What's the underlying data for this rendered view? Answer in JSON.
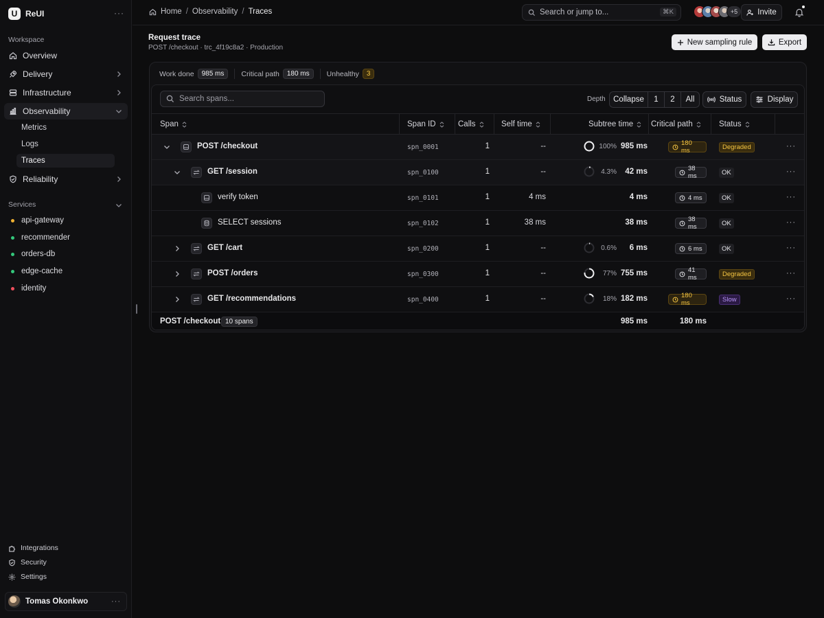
{
  "brand": {
    "name": "ReUI",
    "logo_letter": "U"
  },
  "sidebar": {
    "workspace_label": "Workspace",
    "items": [
      {
        "label": "Overview",
        "icon": "home-icon"
      },
      {
        "label": "Delivery",
        "icon": "rocket-icon"
      },
      {
        "label": "Infrastructure",
        "icon": "server-icon"
      },
      {
        "label": "Observability",
        "icon": "chart-icon"
      },
      {
        "label": "Reliability",
        "icon": "shield-check-icon"
      }
    ],
    "observability_sub": [
      {
        "label": "Metrics"
      },
      {
        "label": "Logs"
      },
      {
        "label": "Traces"
      }
    ],
    "services_label": "Services",
    "services": [
      {
        "label": "api-gateway",
        "color": "#f0b132"
      },
      {
        "label": "recommender",
        "color": "#34c77b"
      },
      {
        "label": "orders-db",
        "color": "#34c77b"
      },
      {
        "label": "edge-cache",
        "color": "#34c77b"
      },
      {
        "label": "identity",
        "color": "#ef4f5d"
      }
    ],
    "bottom_links": [
      {
        "label": "Integrations",
        "icon": "puzzle-icon"
      },
      {
        "label": "Security",
        "icon": "shield-icon"
      },
      {
        "label": "Settings",
        "icon": "gear-icon"
      }
    ],
    "user": {
      "name": "Tomas Okonkwo"
    }
  },
  "topbar": {
    "breadcrumb": [
      "Home",
      "Observability",
      "Traces"
    ],
    "search_placeholder": "Search or jump to...",
    "search_shortcut": "⌘K",
    "avatars_more": "+5",
    "invite_label": "Invite"
  },
  "page": {
    "title": "Request trace",
    "subtitle": "POST /checkout · trc_4f19c8a2 · Production",
    "new_rule_label": "New sampling rule",
    "export_label": "Export"
  },
  "stats": {
    "work_done_label": "Work done",
    "work_done_value": "985 ms",
    "critical_label": "Critical path",
    "critical_value": "180 ms",
    "unhealthy_label": "Unhealthy",
    "unhealthy_value": "3"
  },
  "toolbar": {
    "search_placeholder": "Search spans...",
    "depth_label": "Depth",
    "depth_options": [
      "Collapse",
      "1",
      "2",
      "All"
    ],
    "status_label": "Status",
    "display_label": "Display"
  },
  "columns": {
    "span": "Span",
    "span_id": "Span ID",
    "calls": "Calls",
    "self": "Self time",
    "subtree": "Subtree time",
    "critical": "Critical path",
    "status": "Status"
  },
  "rows": [
    {
      "name": "POST /checkout",
      "id": "spn_0001",
      "calls": "1",
      "self": "--",
      "pct": "100%",
      "frac": 1.0,
      "subtree": "985 ms",
      "cp": "180 ms",
      "cp_warn": true,
      "status": "Degraded"
    },
    {
      "name": "GET /session",
      "id": "spn_0100",
      "calls": "1",
      "self": "--",
      "pct": "4.3%",
      "frac": 0.043,
      "subtree": "42 ms",
      "cp": "38 ms",
      "cp_warn": false,
      "status": "OK"
    },
    {
      "name": "verify token",
      "id": "spn_0101",
      "calls": "1",
      "self": "4 ms",
      "pct": "",
      "frac": null,
      "subtree": "4 ms",
      "cp": "4 ms",
      "cp_warn": false,
      "status": "OK"
    },
    {
      "name": "SELECT sessions",
      "id": "spn_0102",
      "calls": "1",
      "self": "38 ms",
      "pct": "",
      "frac": null,
      "subtree": "38 ms",
      "cp": "38 ms",
      "cp_warn": false,
      "status": "OK"
    },
    {
      "name": "GET /cart",
      "id": "spn_0200",
      "calls": "1",
      "self": "--",
      "pct": "0.6%",
      "frac": 0.006,
      "subtree": "6 ms",
      "cp": "6 ms",
      "cp_warn": false,
      "status": "OK"
    },
    {
      "name": "POST /orders",
      "id": "spn_0300",
      "calls": "1",
      "self": "--",
      "pct": "77%",
      "frac": 0.77,
      "subtree": "755 ms",
      "cp": "41 ms",
      "cp_warn": false,
      "status": "Degraded"
    },
    {
      "name": "GET /recommendations",
      "id": "spn_0400",
      "calls": "1",
      "self": "--",
      "pct": "18%",
      "frac": 0.18,
      "subtree": "182 ms",
      "cp": "180 ms",
      "cp_warn": true,
      "status": "Slow"
    }
  ],
  "footer": {
    "name": "POST /checkout",
    "count": "10 spans",
    "subtree": "985 ms",
    "critical": "180 ms"
  }
}
